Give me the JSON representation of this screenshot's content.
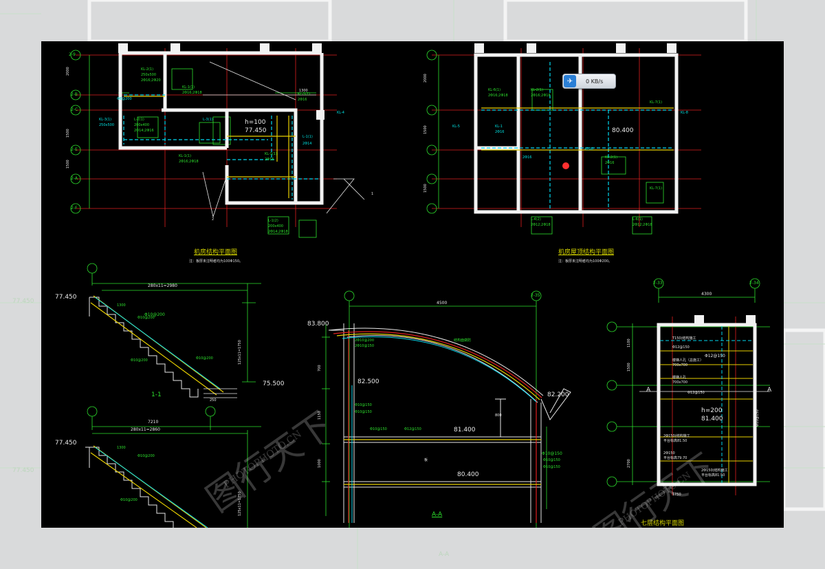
{
  "drawing": {
    "plan_title": "机房结构平面图",
    "plan_note": "注：板厚未注明者均为100Φ150。",
    "roof_title": "机房屋顶结构平面图",
    "roof_note": "注：板厚未注明者均为100Φ200。",
    "stair_title": "1-1",
    "section_title": "A-A",
    "small_plan_title": "七层结构平面图",
    "plan_h": "h=100",
    "plan_elev": "77.450",
    "roof_elev": "80.400",
    "stair1_top": "77.450",
    "stair1_bottom": "75.500",
    "stair2_top": "77.450",
    "stair_dim1": "280x11=2980",
    "stair_dim2": "280x11=2860",
    "stair_dim3": "7210",
    "section_top": "83.800",
    "section_mid": "82.500",
    "section_right": "82.200",
    "section_floor": "81.400",
    "section_base": "80.400",
    "section_dim": "4500",
    "small_dim": "4300",
    "small_h": "h=200",
    "small_elev": "81.400",
    "axis_a": "A",
    "axis_labels": [
      "2-9",
      "2-34",
      "2-33",
      "2-35",
      "2-E",
      "2-F",
      "2-C",
      "2-B",
      "2-A"
    ],
    "rebar1": "Φ10@200",
    "rebar2": "Φ10@150",
    "rebar3": "Φ12@150"
  },
  "network_widget": {
    "speed": "0 KB/s",
    "icon": "bird-icon"
  },
  "watermark": {
    "logo_text": "图行天下",
    "site": "PHOTOPHOTO.CN"
  }
}
